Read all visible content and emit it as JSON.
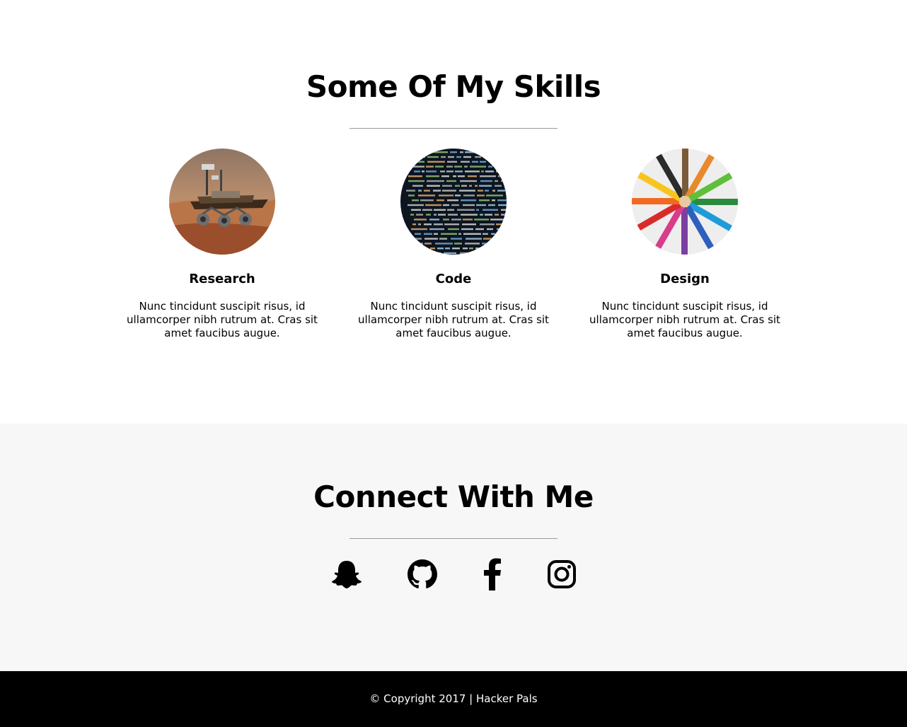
{
  "skills": {
    "title": "Some Of My Skills",
    "items": [
      {
        "title": "Research",
        "image": "mars-rover-photo",
        "description": "Nunc tincidunt suscipit risus, id ullamcorper nibh rutrum at. Cras sit amet faucibus augue."
      },
      {
        "title": "Code",
        "image": "source-code-photo",
        "description": "Nunc tincidunt suscipit risus, id ullamcorper nibh rutrum at. Cras sit amet faucibus augue."
      },
      {
        "title": "Design",
        "image": "colored-pencils-photo",
        "description": "Nunc tincidunt suscipit risus, id ullamcorper nibh rutrum at. Cras sit amet faucibus augue."
      }
    ]
  },
  "connect": {
    "title": "Connect With Me",
    "icons": [
      "snapchat-icon",
      "github-icon",
      "facebook-icon",
      "instagram-icon"
    ]
  },
  "footer": {
    "text": "© Copyright 2017 | Hacker Pals"
  }
}
